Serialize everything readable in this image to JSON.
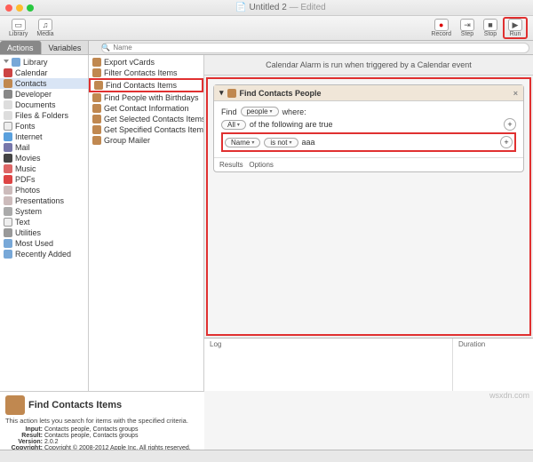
{
  "window": {
    "title": "Untitled 2",
    "edited": "— Edited"
  },
  "toolbar": {
    "library": "Library",
    "media": "Media",
    "record": "Record",
    "step": "Step",
    "stop": "Stop",
    "run": "Run"
  },
  "tabs": {
    "actions": "Actions",
    "variables": "Variables"
  },
  "search": {
    "placeholder": "Name"
  },
  "library": {
    "root": "Library",
    "items": [
      "Calendar",
      "Contacts",
      "Developer",
      "Documents",
      "Files & Folders",
      "Fonts",
      "Internet",
      "Mail",
      "Movies",
      "Music",
      "PDFs",
      "Photos",
      "Presentations",
      "System",
      "Text",
      "Utilities"
    ],
    "footer": [
      "Most Used",
      "Recently Added"
    ]
  },
  "actions": [
    "Export vCards",
    "Filter Contacts Items",
    "Find Contacts Items",
    "Find People with Birthdays",
    "Get Contact Information",
    "Get Selected Contacts Items",
    "Get Specified Contacts Items",
    "Group Mailer"
  ],
  "workflow": {
    "banner": "Calendar Alarm is run when triggered by a Calendar event",
    "action_title": "Find Contacts People",
    "find_label": "Find",
    "find_target": "people",
    "where": "where:",
    "scope": "All",
    "scope_tail": "of the following are true",
    "cond_field": "Name",
    "cond_op": "is not",
    "cond_val": "aaa",
    "results": "Results",
    "options": "Options",
    "log": "Log",
    "duration": "Duration"
  },
  "info": {
    "title": "Find Contacts Items",
    "desc": "This action lets you search for items with the specified criteria.",
    "input_l": "Input:",
    "input_v": "Contacts people, Contacts groups",
    "result_l": "Result:",
    "result_v": "Contacts people, Contacts groups",
    "version_l": "Version:",
    "version_v": "2.0.2",
    "copy_l": "Copyright:",
    "copy_v": "Copyright © 2008-2012 Apple Inc. All rights reserved."
  },
  "watermark": "wsxdn.com"
}
